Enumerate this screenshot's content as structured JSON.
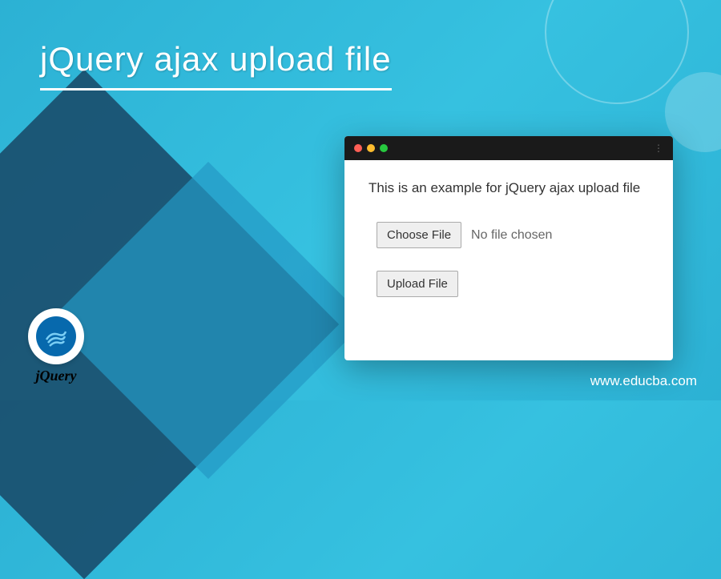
{
  "header": {
    "title": "jQuery ajax upload file"
  },
  "window": {
    "example_text": "This is an example for jQuery ajax upload file",
    "choose_file_label": "Choose File",
    "no_file_text": "No file chosen",
    "upload_file_label": "Upload File"
  },
  "logo": {
    "text": "jQuery"
  },
  "footer": {
    "website": "www.educba.com"
  },
  "colors": {
    "bg_primary": "#2cb1d4",
    "window_bar": "#1a1a1a",
    "logo_bg": "#0769ad"
  }
}
